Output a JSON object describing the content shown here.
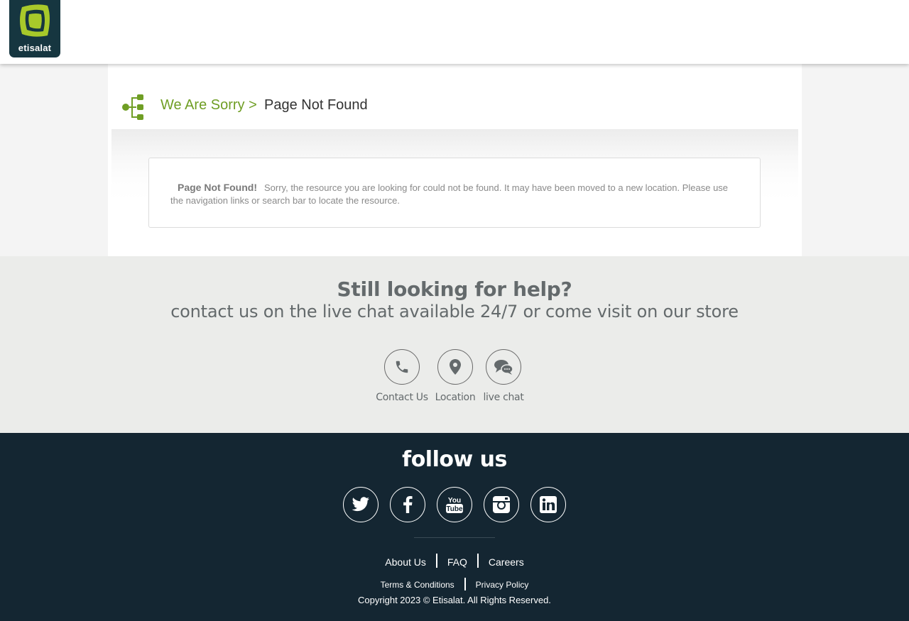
{
  "header": {
    "logo_text": "etisalat",
    "logo_icon": "etisalat-logo"
  },
  "breadcrumb": {
    "icon": "sitemap-icon",
    "parent": "We Are Sorry >",
    "current": "Page Not Found"
  },
  "message": {
    "title": "Page Not Found!",
    "body": "Sorry, the resource you are looking for could not be found. It may have been moved to a new location. Please use the navigation links or search bar to locate the resource."
  },
  "help": {
    "title": "Still looking for help?",
    "subtitle": "contact us on the live chat available 24/7 or come visit on our store",
    "items": [
      {
        "label": "Contact Us",
        "icon": "phone-icon"
      },
      {
        "label": "Location",
        "icon": "location-pin-icon"
      },
      {
        "label": "live chat",
        "icon": "chat-icon"
      }
    ]
  },
  "footer": {
    "follow_title": "follow us",
    "social": [
      "twitter-icon",
      "facebook-icon",
      "youtube-icon",
      "instagram-icon",
      "linkedin-icon"
    ],
    "links": [
      "About Us",
      "FAQ",
      "Careers"
    ],
    "sub_links": [
      "Terms & Conditions",
      "Privacy Policy"
    ],
    "copyright": "Copyright 2023 © Etisalat. All Rights Reserved."
  },
  "colors": {
    "brand_green": "#6f9e24",
    "footer_bg": "#142632",
    "help_bg": "#ebecea",
    "logo_bg": "#163640"
  }
}
